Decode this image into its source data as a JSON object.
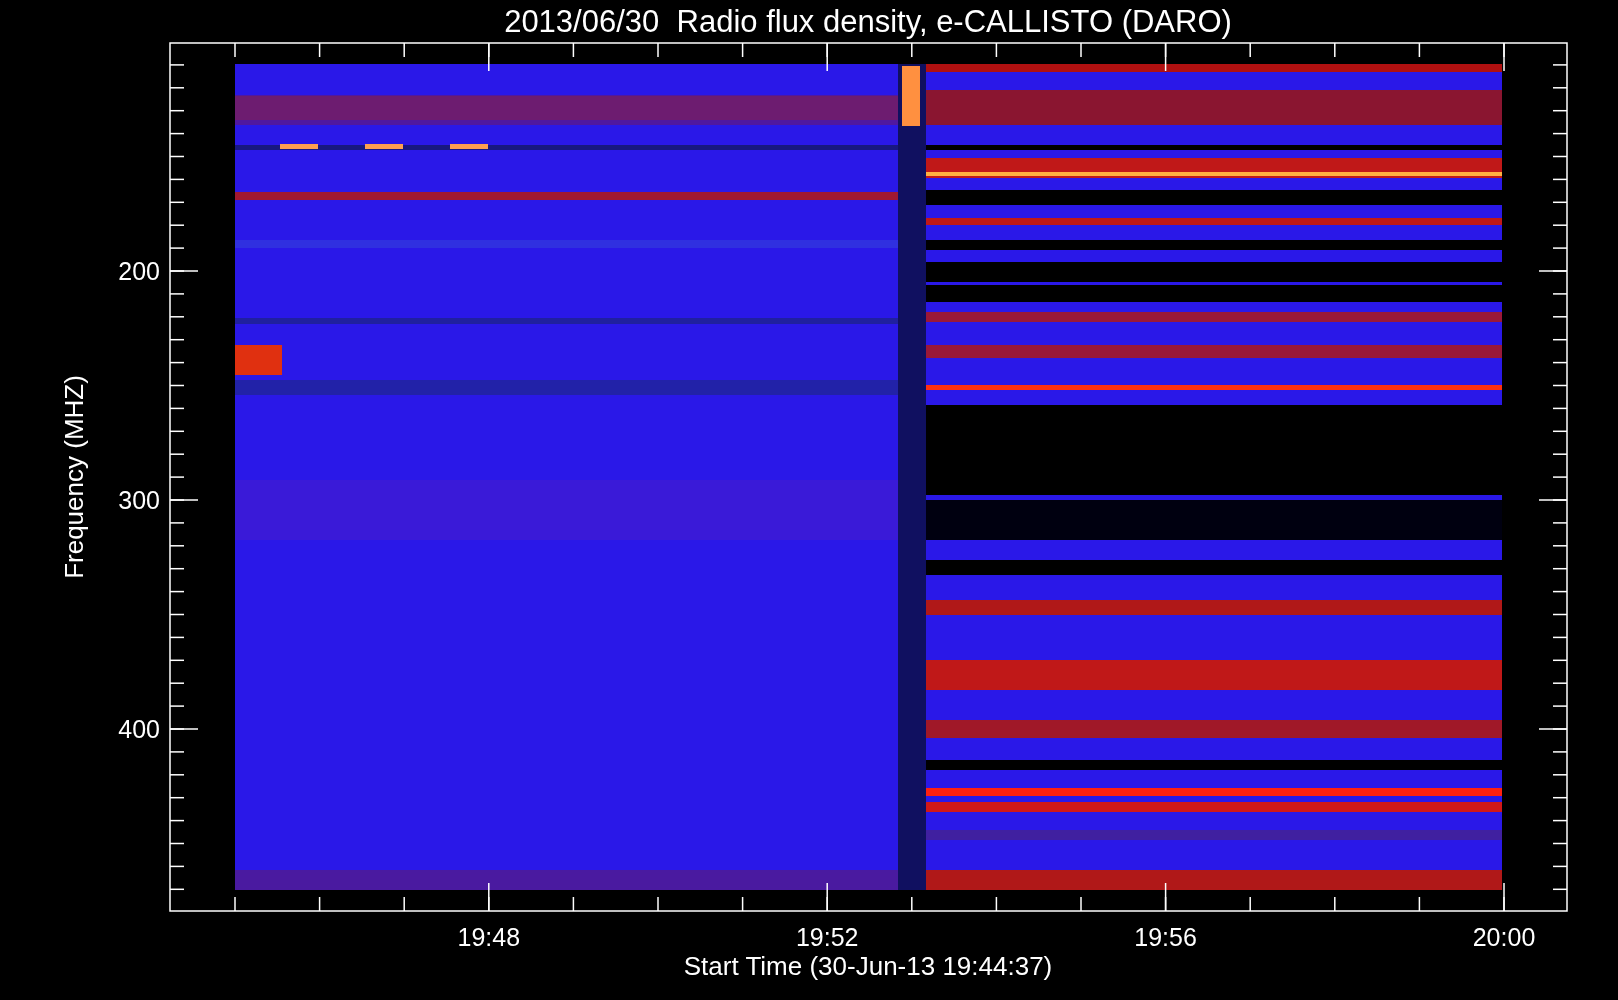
{
  "title": "2013/06/30  Radio flux density, e-CALLISTO (DARO)",
  "y_axis": {
    "label": "Frequency (MHZ)",
    "ticks": [
      "200",
      "300",
      "400"
    ]
  },
  "x_axis": {
    "label": "Start Time (30-Jun-13 19:44:37)",
    "ticks": [
      "19:48",
      "19:52",
      "19:56",
      "20:00"
    ]
  }
}
